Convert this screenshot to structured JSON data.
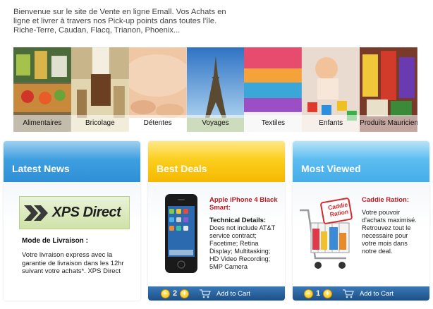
{
  "intro": {
    "text": "Bienvenue sur le site de Vente en ligne Emall. Vos Achats en ligne et livrer à travers nos Pick-up points dans toutes l'île. Riche-Terre, Caudan, Flacq, Trianon, Phoenix..."
  },
  "categories": [
    {
      "label": "Alimentaires"
    },
    {
      "label": "Bricolage"
    },
    {
      "label": "Détentes"
    },
    {
      "label": "Voyages"
    },
    {
      "label": "Textiles"
    },
    {
      "label": "Enfants"
    },
    {
      "label": "Produits Mauricien"
    }
  ],
  "latest_news": {
    "title": "Latest News",
    "logo_text": "XPS Direct",
    "subtitle": "Mode de Livraison :",
    "body": "Votre livraison express avec la garantie de livraison dans les 12hr suivant votre achats*. XPS Direct"
  },
  "best_deals": {
    "title": "Best Deals",
    "product_title": "Apple iPhone 4 Black Smart:",
    "details_label": "Technical Details:",
    "details_text": "Does not include AT&T service contract; Facetime; Retina Display; Multitasking; HD Video Recording; 5MP Camera",
    "quantity": "2",
    "add_to_cart": "Add to Cart"
  },
  "most_viewed": {
    "title": "Most Viewed",
    "product_title": "Caddie Ration:",
    "sign_text": "Caddie Ration",
    "body": "Votre pouvoir d'achats maximisé. Retrouvez tout le necessaire pour votre mois dans notre deal.",
    "quantity": "1",
    "add_to_cart": "Add to Cart"
  },
  "colors": {
    "news_header": "#3e9fe0",
    "deals_header": "#fbcf1e",
    "viewed_header": "#5cbdf0",
    "cart_bar": "#1d4f86",
    "product_title": "#c0171f"
  },
  "icons": {
    "minus": "minus-icon",
    "plus": "plus-icon",
    "cart": "shopping-cart-icon"
  }
}
